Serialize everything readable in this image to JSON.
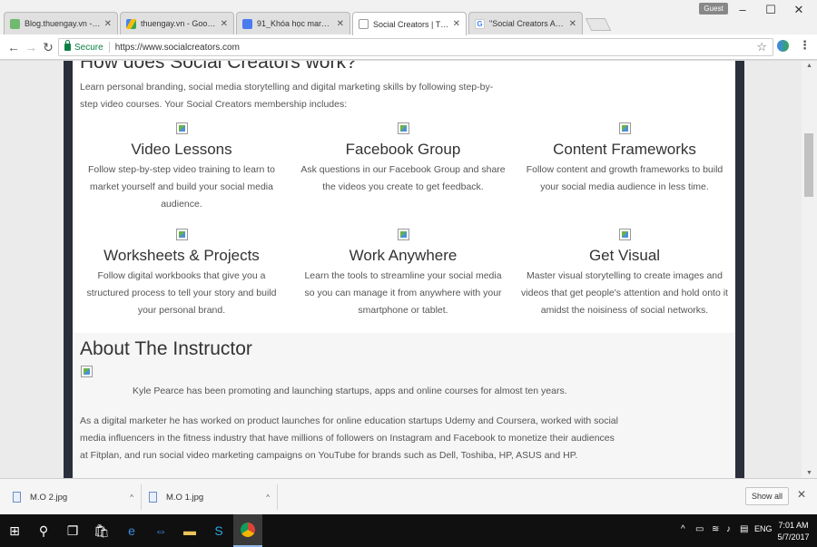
{
  "browser": {
    "tabs": [
      {
        "title": "Blog.thuengay.vn - Goo",
        "favicon": "blogger-icon",
        "active": false
      },
      {
        "title": "thuengay.vn - Google D",
        "favicon": "drive-icon",
        "active": false
      },
      {
        "title": "91_Khóa học marketing",
        "favicon": "docs-icon",
        "active": false
      },
      {
        "title": "Social Creators | The Pe",
        "favicon": "page-icon",
        "active": true
      },
      {
        "title": "\"Social Creators Acade",
        "favicon": "google-icon",
        "active": false
      }
    ],
    "profile_label": "Guest",
    "security_label": "Secure",
    "url": "https://www.socialcreators.com"
  },
  "page": {
    "how_title": "How does Social Creators work?",
    "intro": "Learn personal branding, social media storytelling and digital marketing skills by following step-by-step video courses. Your Social Creators membership includes:",
    "features": [
      {
        "title": "Video Lessons",
        "description": "Follow step-by-step video training to learn to market yourself and build your social media audience."
      },
      {
        "title": "Facebook Group",
        "description": "Ask questions in our Facebook Group and share the videos you create to get feedback."
      },
      {
        "title": "Content Frameworks",
        "description": "Follow content and growth frameworks to build your social media audience in less time."
      },
      {
        "title": "Worksheets & Projects",
        "description": "Follow digital workbooks that give you a structured process to tell your story and build your personal brand."
      },
      {
        "title": "Work Anywhere",
        "description": "Learn the tools to streamline your social media so you can manage it from anywhere with your smartphone or tablet."
      },
      {
        "title": "Get Visual",
        "description": "Master visual storytelling to create images and videos that get people's attention and hold onto it amidst the noisiness of social networks."
      }
    ],
    "about_title": "About The Instructor",
    "about_lead": "Kyle Pearce has been promoting and launching startups, apps and online courses for almost ten years.",
    "about_body": "As a digital marketer he has worked on product launches for online education startups Udemy and Coursera, worked with social media influencers in the fitness industry that have millions of followers on Instagram and Facebook to monetize their audiences at Fitplan, and run social video marketing campaigns on YouTube for brands such as Dell, Toshiba, HP, ASUS and HP."
  },
  "downloads": {
    "items": [
      {
        "name": "M.O 2.jpg"
      },
      {
        "name": "M.O 1.jpg"
      }
    ],
    "show_all_label": "Show all"
  },
  "taskbar": {
    "language": "ENG",
    "time": "7:01 AM",
    "date": "5/7/2017"
  },
  "colors": {
    "secure_green": "#0b8043",
    "page_rail": "#2a2f3b",
    "taskbar": "#101010"
  }
}
